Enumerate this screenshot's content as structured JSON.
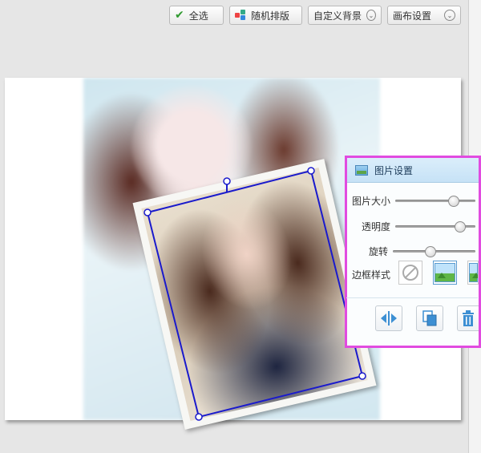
{
  "toolbar": {
    "select_all": "全选",
    "random_layout": "随机排版",
    "custom_background": "自定义背景",
    "canvas_settings": "画布设置"
  },
  "icons": {
    "select_all": "check-icon",
    "random_layout": "dice-icon",
    "dropdown": "chevron-down-icon"
  },
  "panel": {
    "title": "图片设置",
    "size_label": "图片大小",
    "size_value": 0.78,
    "opacity_label": "透明度",
    "opacity_value": 0.82,
    "rotate_label": "旋转",
    "rotate_value": 0.45,
    "border_style_label": "边框样式",
    "actions": [
      "flip-horizontal-icon",
      "copy-icon",
      "delete-icon"
    ]
  },
  "colors": {
    "highlight_border": "#e14be0",
    "selection_border": "#1a1acc",
    "accent_blue": "#3d8fd3"
  }
}
